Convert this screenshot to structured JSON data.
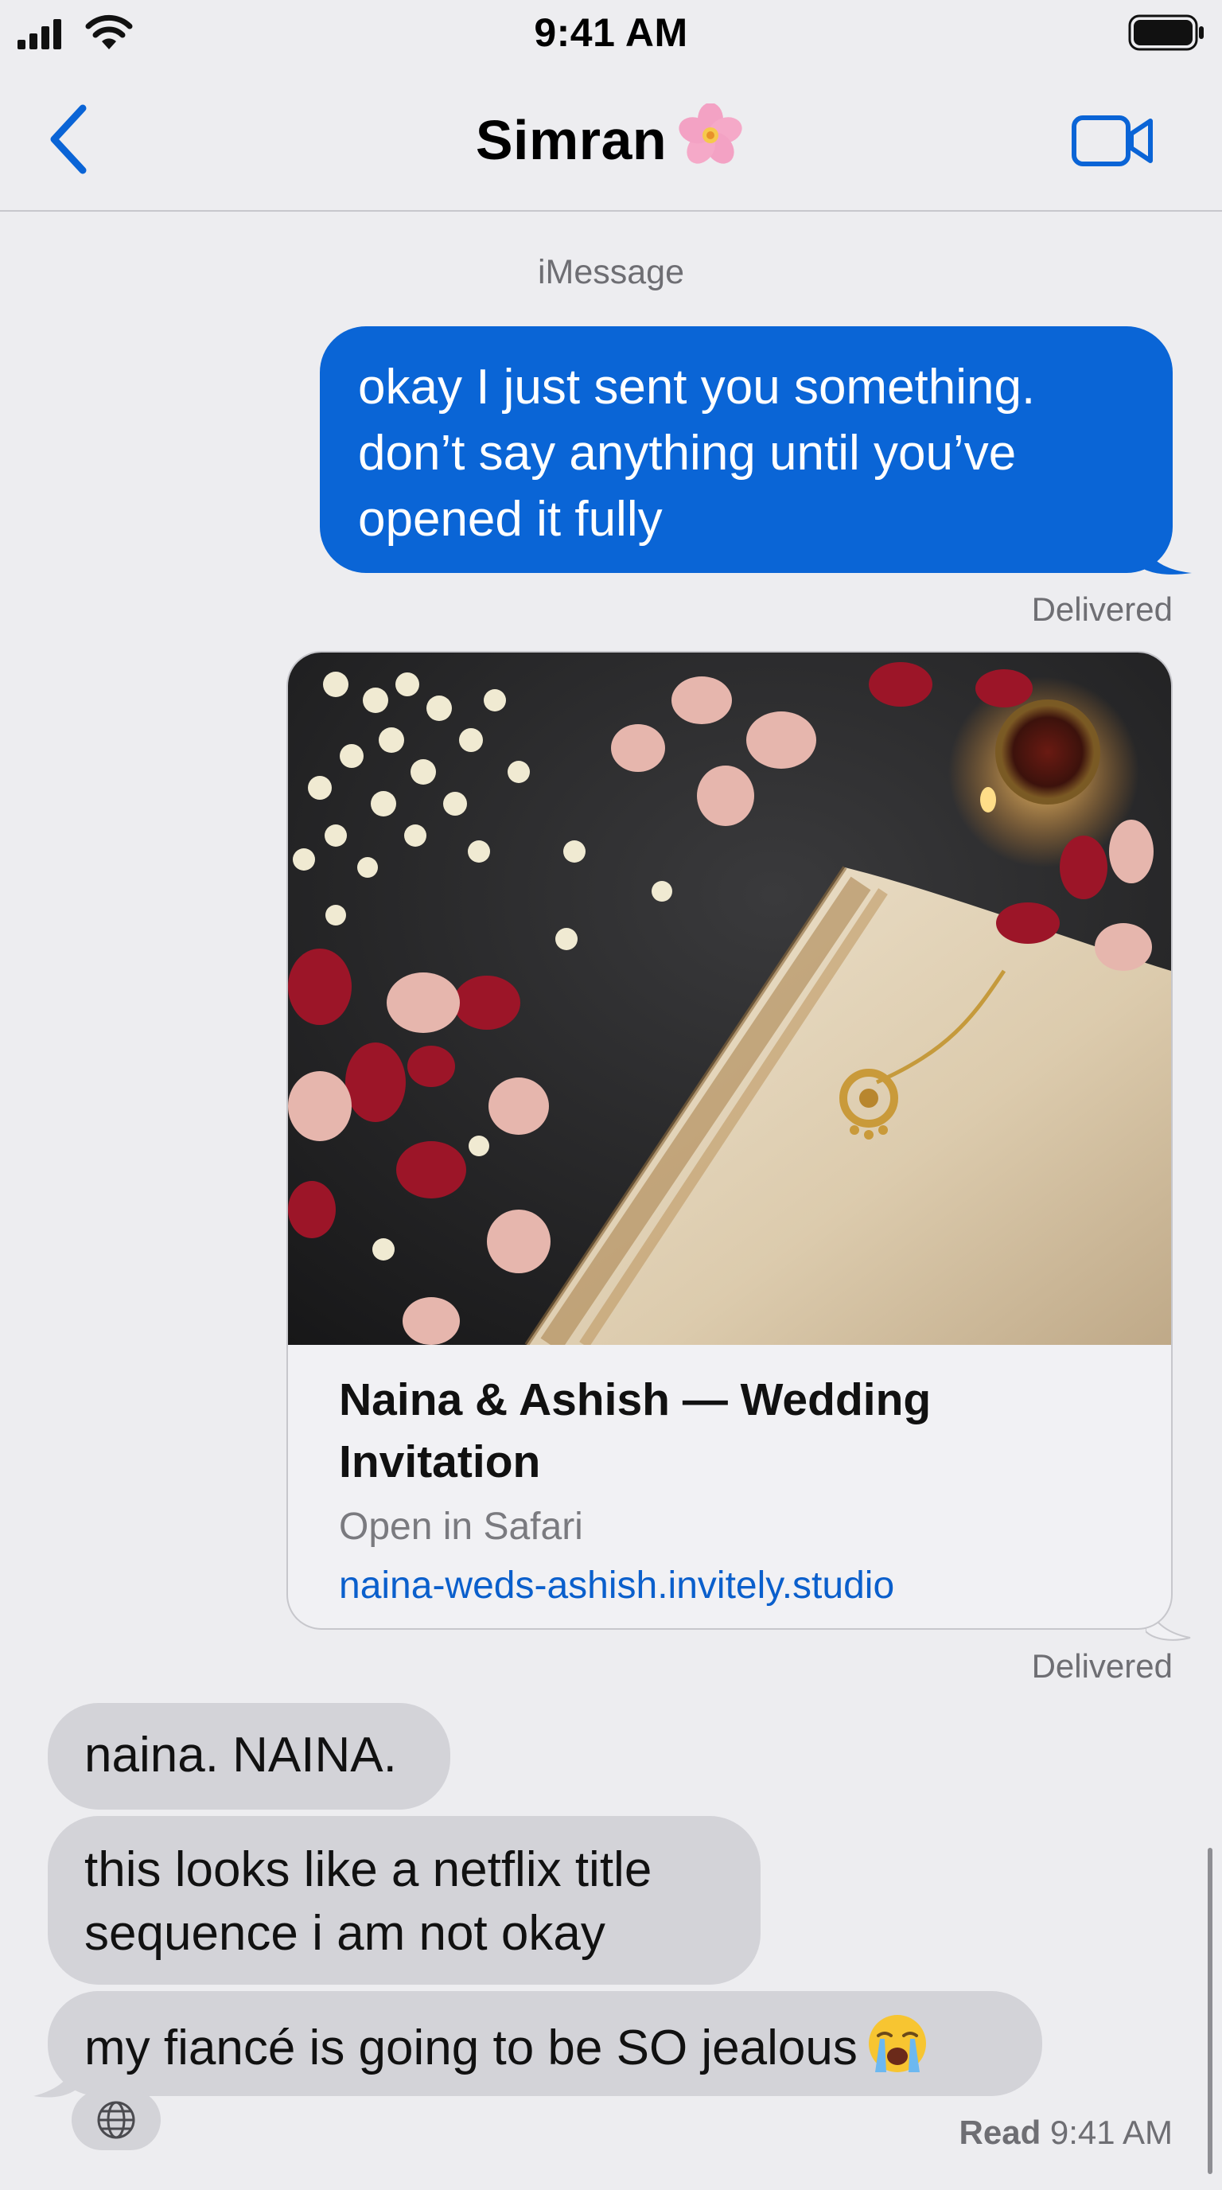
{
  "status_bar": {
    "time": "9:41 AM"
  },
  "header": {
    "contact_name": "Simran",
    "contact_emoji": "flower-emoji",
    "back_icon": "chevron-left-icon",
    "video_icon": "video-camera-icon"
  },
  "thread": {
    "service_label": "iMessage",
    "outgoing_message": "okay I just sent you something. don’t say anything until you’ve opened it fully",
    "delivered_1": "Delivered",
    "link_preview": {
      "title": "Naina & Ashish — Wedding Invitation",
      "subtitle": "Open in Safari",
      "url": "naina-weds-ashish.invitely.studio"
    },
    "delivered_2": "Delivered",
    "incoming": [
      {
        "text": "naina. NAINA."
      },
      {
        "text": "this looks like a netflix title sequence  i am not okay"
      },
      {
        "text": "my fiancé is going to be SO jealous",
        "emoji": "loudly-crying-face-emoji"
      }
    ],
    "read_receipt": {
      "label": "Read",
      "time": "9:41 AM"
    }
  },
  "colors": {
    "outgoing_bubble": "#0a65d6",
    "incoming_bubble": "#d3d3d8",
    "background": "#ededf0",
    "link": "#0a5fcc"
  }
}
